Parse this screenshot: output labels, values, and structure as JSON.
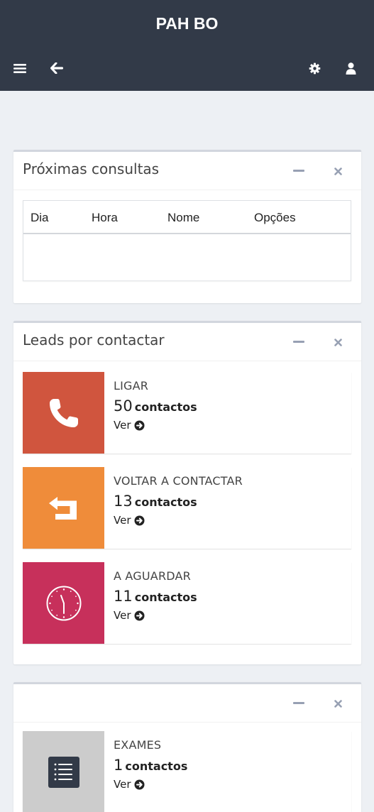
{
  "header": {
    "brand": "PAH BO",
    "icons": [
      "bars-icon",
      "arrow-left-icon",
      "gear-icon",
      "user-icon"
    ]
  },
  "colors": {
    "topbar": "#323a48",
    "background": "#edf0f4",
    "ligar": "#d0553e",
    "voltar": "#ef8c3a",
    "aguardar": "#c7305b",
    "exames": "#cccccc"
  },
  "panels": {
    "consultas": {
      "title": "Próximas consultas",
      "columns": [
        "Dia",
        "Hora",
        "Nome",
        "Opções"
      ]
    },
    "leads": {
      "title": "Leads por contactar",
      "boxes": [
        {
          "label": "LIGAR",
          "count": "50",
          "unit": "contactos",
          "link": "Ver",
          "icon": "phone-icon"
        },
        {
          "label": "VOLTAR A CONTACTAR",
          "count": "13",
          "unit": "contactos",
          "link": "Ver",
          "icon": "reply-arrow-icon"
        },
        {
          "label": "A AGUARDAR",
          "count": "11",
          "unit": "contactos",
          "link": "Ver",
          "icon": "clock-icon"
        }
      ]
    },
    "exames": {
      "title": "",
      "boxes": [
        {
          "label": "EXAMES",
          "count": "1",
          "unit": "contactos",
          "link": "Ver",
          "icon": "list-icon"
        }
      ]
    }
  }
}
